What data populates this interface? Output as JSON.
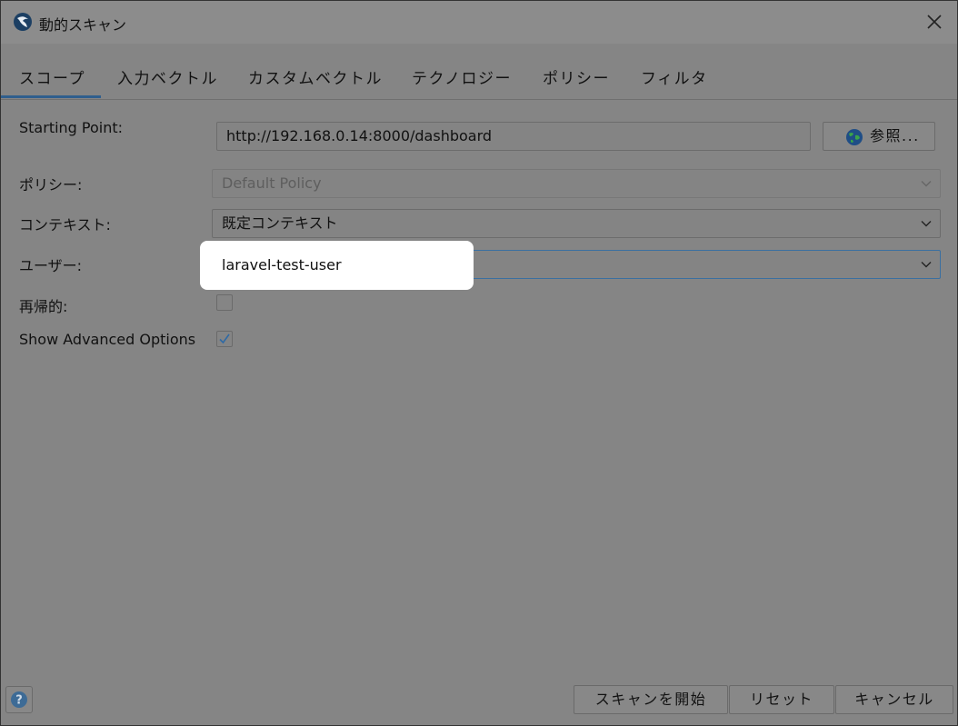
{
  "window": {
    "title": "動的スキャン"
  },
  "tabs": [
    {
      "label": "スコープ",
      "active": true
    },
    {
      "label": "入力ベクトル"
    },
    {
      "label": "カスタムベクトル"
    },
    {
      "label": "テクノロジー"
    },
    {
      "label": "ポリシー"
    },
    {
      "label": "フィルタ"
    }
  ],
  "form": {
    "starting_point": {
      "label": "Starting Point:",
      "value": "http://192.168.0.14:8000/dashboard",
      "browse_label": "参照..."
    },
    "policy": {
      "label": "ポリシー:",
      "value": "Default Policy",
      "enabled": false
    },
    "context": {
      "label": "コンテキスト:",
      "value": "既定コンテキスト"
    },
    "user": {
      "label": "ユーザー:",
      "value": "laravel-test-user"
    },
    "recurse": {
      "label": "再帰的:",
      "checked": false
    },
    "advanced": {
      "label": "Show Advanced Options",
      "checked": true
    }
  },
  "footer": {
    "start_label": "スキャンを開始",
    "reset_label": "リセット",
    "cancel_label": "キャンセル"
  },
  "icons": {
    "app": "zap-icon",
    "close": "close-icon",
    "globe": "globe-icon",
    "help": "help-icon",
    "chevron": "chevron-down-icon"
  },
  "colors": {
    "accent": "#2f5e8d",
    "check": "#2f6aa5"
  }
}
